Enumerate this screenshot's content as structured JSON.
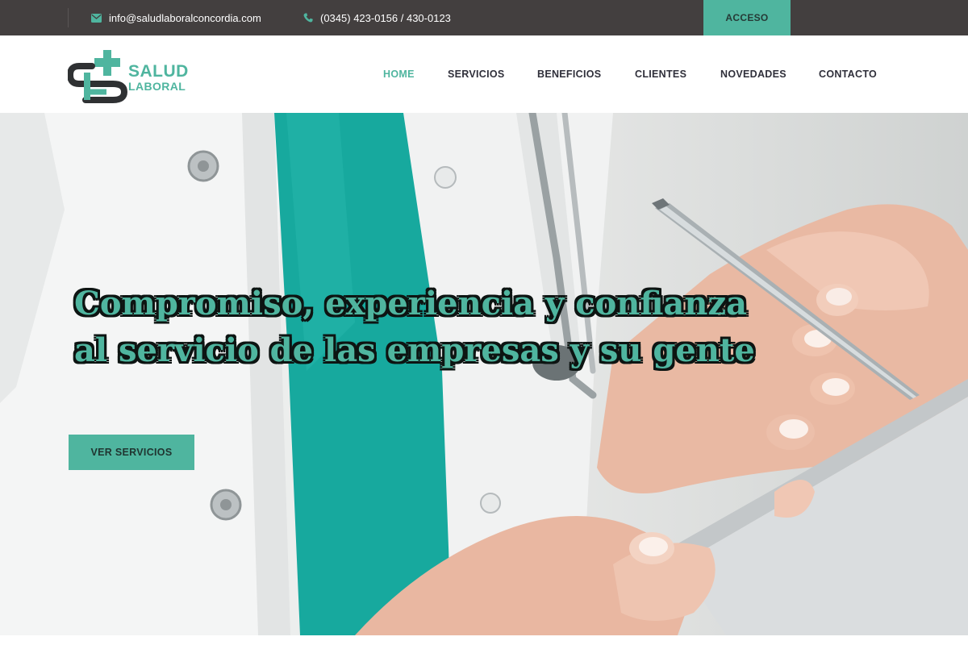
{
  "topbar": {
    "email": "info@saludlaboralconcordia.com",
    "phone": "(0345) 423-0156 / 430-0123",
    "access_label": "ACCESO",
    "email_icon": "envelope-icon",
    "phone_icon": "phone-icon"
  },
  "brand": {
    "line1": "SALUD",
    "line2": "LABORAL",
    "logo_icon": "medical-cross-logo"
  },
  "nav": {
    "items": [
      {
        "label": "HOME",
        "active": true
      },
      {
        "label": "SERVICIOS",
        "active": false
      },
      {
        "label": "BENEFICIOS",
        "active": false
      },
      {
        "label": "CLIENTES",
        "active": false
      },
      {
        "label": "NOVEDADES",
        "active": false
      },
      {
        "label": "CONTACTO",
        "active": false
      }
    ]
  },
  "hero": {
    "headline_line1": "Compromiso, experiencia y confianza",
    "headline_line2": "al servicio de las empresas y su gente",
    "cta_label": "VER SERVICIOS"
  },
  "colors": {
    "accent": "#4fb59f",
    "topbar_bg": "#433f3f",
    "nav_text": "#2f2f3a",
    "headline_outline": "#0d1412"
  }
}
